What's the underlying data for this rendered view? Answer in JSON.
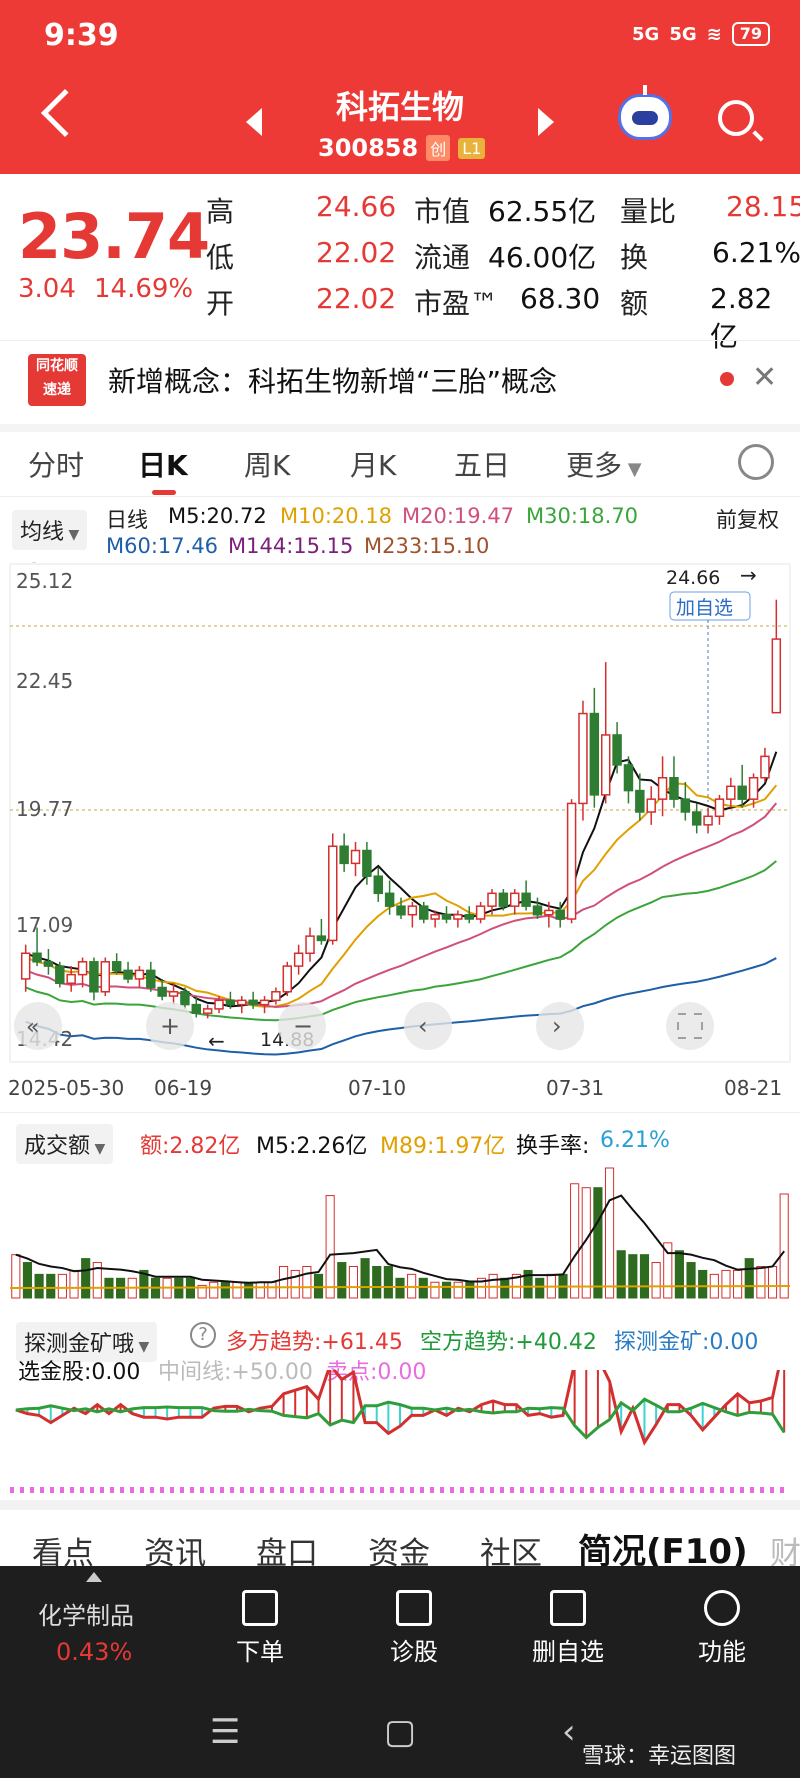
{
  "status": {
    "time": "9:39",
    "network1": "5G",
    "network2": "5G",
    "battery": "79"
  },
  "header": {
    "stock_name": "科拓生物",
    "stock_code": "300858",
    "badge1": "创",
    "badge2": "L1"
  },
  "quote": {
    "price": "23.74",
    "change": "3.04",
    "change_pct": "14.69%",
    "high_label": "高",
    "high": "24.66",
    "low_label": "低",
    "low": "22.02",
    "open_label": "开",
    "open": "22.02",
    "mktcap_label": "市值",
    "mktcap": "62.55亿",
    "float_label": "流通",
    "float": "46.00亿",
    "pe_label": "市盈™",
    "pe": "68.30",
    "vr_label": "量比",
    "vr": "28.15",
    "turn_label": "换",
    "turn": "6.21%",
    "amt_label": "额",
    "amt": "2.82亿"
  },
  "news": {
    "logo_line1": "同花顺",
    "logo_line2": "速递",
    "text": "新增概念：科拓生物新增“三胎”概念"
  },
  "chart_tabs": [
    "分时",
    "日K",
    "周K",
    "月K",
    "五日",
    "更多"
  ],
  "ma": {
    "selector": "均线",
    "period": "日线",
    "m5": "M5:20.72",
    "m10": "M10:20.18",
    "m20": "M20:19.47",
    "m30": "M30:18.70",
    "m60": "M60:17.46",
    "m144": "M144:15.15",
    "m233": "M233:15.10",
    "adjust": "前复权",
    "colors": {
      "m5": "#111111",
      "m10": "#e0a000",
      "m20": "#d0507a",
      "m30": "#3aa53a",
      "m60": "#1f5fa8",
      "m144": "#7a1f7a",
      "m233": "#a0522d"
    }
  },
  "kchart": {
    "y_labels": [
      "25.12",
      "22.45",
      "19.77",
      "17.09",
      "14.42"
    ],
    "high_marker": "24.66",
    "low_marker": "14.88",
    "watch_label": "加自选",
    "dates": [
      "2025-05-30",
      "06-19",
      "07-10",
      "07-31",
      "08-21"
    ]
  },
  "chart_data": {
    "type": "candlestick",
    "ylim": [
      14.42,
      25.12
    ],
    "candles": [
      [
        15.8,
        16.6,
        15.5,
        16.4
      ],
      [
        16.4,
        17.0,
        16.1,
        16.2
      ],
      [
        16.2,
        16.5,
        15.9,
        16.1
      ],
      [
        16.1,
        16.2,
        15.6,
        15.7
      ],
      [
        15.7,
        16.1,
        15.5,
        15.9
      ],
      [
        15.9,
        16.3,
        15.6,
        16.2
      ],
      [
        16.2,
        16.3,
        15.3,
        15.5
      ],
      [
        15.5,
        16.3,
        15.4,
        16.2
      ],
      [
        16.2,
        16.4,
        15.9,
        16.0
      ],
      [
        16.0,
        16.2,
        15.7,
        15.8
      ],
      [
        15.8,
        16.1,
        15.6,
        16.0
      ],
      [
        16.0,
        16.2,
        15.5,
        15.6
      ],
      [
        15.6,
        15.8,
        15.3,
        15.4
      ],
      [
        15.4,
        15.7,
        15.2,
        15.5
      ],
      [
        15.5,
        15.6,
        15.1,
        15.2
      ],
      [
        15.2,
        15.4,
        14.9,
        15.0
      ],
      [
        15.0,
        15.2,
        14.88,
        15.1
      ],
      [
        15.1,
        15.4,
        15.0,
        15.3
      ],
      [
        15.3,
        15.5,
        15.1,
        15.2
      ],
      [
        15.2,
        15.4,
        15.0,
        15.3
      ],
      [
        15.3,
        15.5,
        15.1,
        15.2
      ],
      [
        15.2,
        15.4,
        15.0,
        15.3
      ],
      [
        15.3,
        15.6,
        15.2,
        15.5
      ],
      [
        15.5,
        16.2,
        15.4,
        16.1
      ],
      [
        16.1,
        16.6,
        15.9,
        16.4
      ],
      [
        16.4,
        17.0,
        16.2,
        16.8
      ],
      [
        16.8,
        17.2,
        16.6,
        16.7
      ],
      [
        16.7,
        19.2,
        16.6,
        18.9
      ],
      [
        18.9,
        19.2,
        18.3,
        18.5
      ],
      [
        18.5,
        19.0,
        18.2,
        18.8
      ],
      [
        18.8,
        19.0,
        18.0,
        18.2
      ],
      [
        18.2,
        18.4,
        17.6,
        17.8
      ],
      [
        17.8,
        18.1,
        17.3,
        17.5
      ],
      [
        17.5,
        17.7,
        17.2,
        17.3
      ],
      [
        17.3,
        17.6,
        17.0,
        17.5
      ],
      [
        17.5,
        17.6,
        17.1,
        17.2
      ],
      [
        17.2,
        17.4,
        17.0,
        17.3
      ],
      [
        17.3,
        17.5,
        17.1,
        17.2
      ],
      [
        17.2,
        17.4,
        17.0,
        17.3
      ],
      [
        17.3,
        17.5,
        17.1,
        17.2
      ],
      [
        17.2,
        17.6,
        17.1,
        17.5
      ],
      [
        17.5,
        17.9,
        17.3,
        17.8
      ],
      [
        17.8,
        17.9,
        17.4,
        17.5
      ],
      [
        17.5,
        17.9,
        17.3,
        17.8
      ],
      [
        17.8,
        18.1,
        17.4,
        17.5
      ],
      [
        17.5,
        17.7,
        17.2,
        17.3
      ],
      [
        17.3,
        17.6,
        17.0,
        17.4
      ],
      [
        17.4,
        17.6,
        17.0,
        17.2
      ],
      [
        17.2,
        20.0,
        17.1,
        19.9
      ],
      [
        19.9,
        22.3,
        19.5,
        22.0
      ],
      [
        22.0,
        22.6,
        19.8,
        20.1
      ],
      [
        20.1,
        23.2,
        19.9,
        21.5
      ],
      [
        21.5,
        21.8,
        20.6,
        20.8
      ],
      [
        20.8,
        21.0,
        19.9,
        20.2
      ],
      [
        20.2,
        20.6,
        19.5,
        19.7
      ],
      [
        19.7,
        20.3,
        19.4,
        20.0
      ],
      [
        20.0,
        21.0,
        19.6,
        20.5
      ],
      [
        20.5,
        21.0,
        19.8,
        20.0
      ],
      [
        20.0,
        20.4,
        19.5,
        19.7
      ],
      [
        19.7,
        19.9,
        19.2,
        19.4
      ],
      [
        19.4,
        19.8,
        19.2,
        19.6
      ],
      [
        19.6,
        20.1,
        19.4,
        20.0
      ],
      [
        20.0,
        20.5,
        19.8,
        20.3
      ],
      [
        20.3,
        20.8,
        19.8,
        20.0
      ],
      [
        20.0,
        20.6,
        19.8,
        20.5
      ],
      [
        20.5,
        21.2,
        20.4,
        21.0
      ],
      [
        22.02,
        24.66,
        22.02,
        23.74
      ]
    ]
  },
  "volume": {
    "selector": "成交额",
    "amt": "额:2.82亿",
    "m5": "M5:2.26亿",
    "m89": "M89:1.97亿",
    "turnover_label": "换手率:",
    "turnover": "6.21%"
  },
  "indicator": {
    "selector": "探测金矿哦",
    "help_icon": "?",
    "long": "多方趋势:+61.45",
    "short": "空方趋势:+40.42",
    "probe": "探测金矿:0.00",
    "gold": "选金股:0.00",
    "mid": "中间线:+50.00",
    "sell": "卖点:0.00"
  },
  "bottom_tabs": [
    "看点",
    "资讯",
    "盘口",
    "资金",
    "社区",
    "简况(F10)",
    "财"
  ],
  "bottom_bar": {
    "sector": "化学制品",
    "sector_pct": "0.43%",
    "order": "下单",
    "diagnose": "诊股",
    "remove": "删自选",
    "func": "功能"
  },
  "watermark": "雪球：幸运图图"
}
